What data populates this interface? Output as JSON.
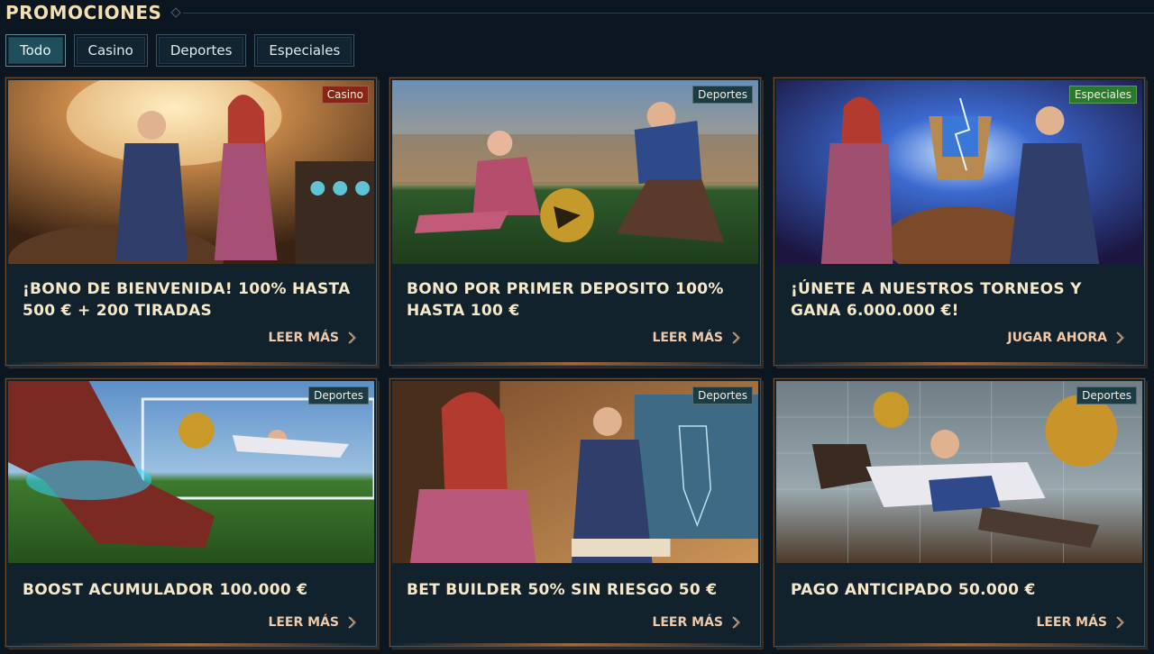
{
  "header": {
    "title": "PROMOCIONES"
  },
  "filters": [
    {
      "label": "Todo",
      "active": true
    },
    {
      "label": "Casino",
      "active": false
    },
    {
      "label": "Deportes",
      "active": false
    },
    {
      "label": "Especiales",
      "active": false
    }
  ],
  "promotions": [
    {
      "badge": "Casino",
      "title": "¡BONO DE BIENVENIDA! 100% HASTA 500 € + 200 TIRADAS",
      "cta": "LEER MÁS"
    },
    {
      "badge": "Deportes",
      "title": "BONO POR PRIMER DEPOSITO 100% HASTA 100 €",
      "cta": "LEER MÁS"
    },
    {
      "badge": "Especiales",
      "title": "¡ÚNETE A NUESTROS TORNEOS Y GANA 6.000.000 €!",
      "cta": "JUGAR AHORA"
    },
    {
      "badge": "Deportes",
      "title": "BOOST ACUMULADOR 100.000 €",
      "cta": "LEER MÁS"
    },
    {
      "badge": "Deportes",
      "title": "BET BUILDER 50% SIN RIESGO 50 €",
      "cta": "LEER MÁS"
    },
    {
      "badge": "Deportes",
      "title": "PAGO ANTICIPADO 50.000 €",
      "cta": "LEER MÁS"
    }
  ],
  "colors": {
    "background": "#0b1620",
    "card": "#11222d",
    "title_text": "#f6e9c9",
    "cta_text": "#f0c9a9",
    "badge_casino": "#8a2415",
    "badge_deportes": "#1b3b45",
    "badge_especiales": "#2a7a2c"
  }
}
